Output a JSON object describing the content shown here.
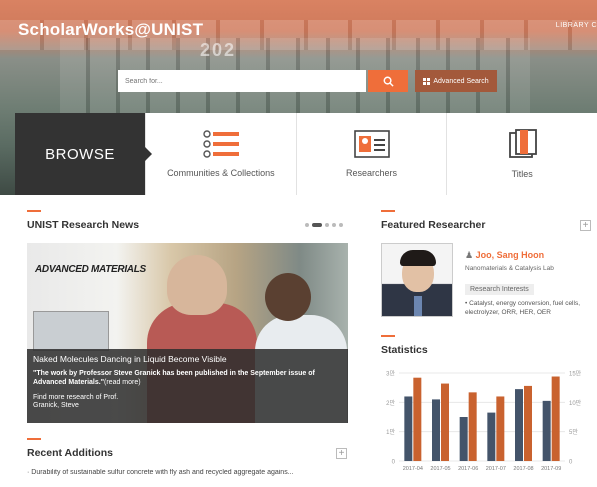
{
  "header": {
    "logo": "ScholarWorks@UNIST",
    "top_right": "LIBRARY C",
    "building_number": "202",
    "search_placeholder": "Search for...",
    "advanced_search": "Advanced Search"
  },
  "browse": {
    "label": "BROWSE",
    "items": [
      {
        "label": "Communities & Collections",
        "icon": "list-icon"
      },
      {
        "label": "Researchers",
        "icon": "id-card-icon"
      },
      {
        "label": "Titles",
        "icon": "book-icon"
      }
    ]
  },
  "news": {
    "title": "UNIST Research News",
    "journal": "ADVANCED MATERIALS",
    "headline": "Naked Molecules Dancing in Liquid Become Visible",
    "quote": "\"The work by Professor Steve Granick has been published in the September issue of Advanced Materials.\"",
    "read_more": "(read more)",
    "more_1": "Find more research of Prof.",
    "more_2": "Granick, Steve"
  },
  "recent": {
    "title": "Recent Additions",
    "items": [
      "Durability of sustainable sulfur concrete with fly ash and recycled aggregate agains..."
    ]
  },
  "featured": {
    "title": "Featured Researcher",
    "name": "Joo, Sang Hoon",
    "lab": "Nanomaterials & Catalysis Lab",
    "tag": "Research Interests",
    "interests": "Catalyst, energy conversion, fuel cells, electrolyzer, ORR, HER, OER"
  },
  "statistics": {
    "title": "Statistics"
  },
  "colors": {
    "accent": "#ef6e3a",
    "bar_dark": "#44546a",
    "bar_orange": "#c9622f"
  },
  "chart_data": {
    "type": "bar",
    "categories": [
      "2017-04",
      "2017-05",
      "2017-06",
      "2017-07",
      "2017-08",
      "2017-09"
    ],
    "series": [
      {
        "values": [
          2.2,
          2.1,
          1.5,
          1.65,
          2.45,
          2.05
        ]
      },
      {
        "values": [
          14.2,
          13.2,
          11.7,
          11.0,
          12.8,
          14.4
        ]
      }
    ],
    "y_left": {
      "ticks": [
        "0",
        "1만",
        "2만",
        "3만"
      ],
      "range": [
        0,
        3
      ]
    },
    "y_right": {
      "ticks": [
        "0",
        "5만",
        "10만",
        "15만"
      ],
      "range": [
        0,
        15
      ]
    },
    "grid": true
  }
}
